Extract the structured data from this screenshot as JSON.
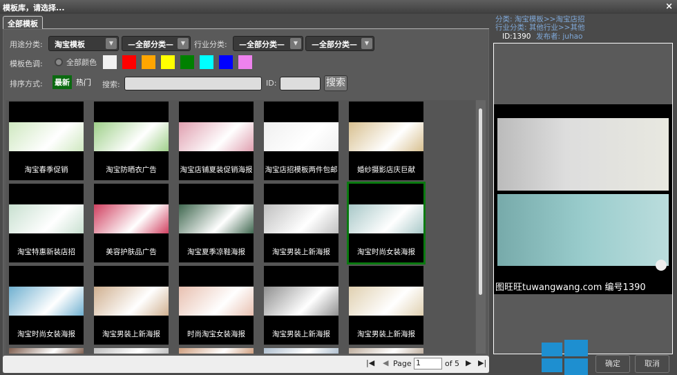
{
  "window": {
    "title": "模板库，请选择...",
    "close": "×"
  },
  "tab": "全部模板",
  "filters": {
    "usage_label": "用途分类:",
    "usage_value": "淘宝模板",
    "usage_sub": "—全部分类—",
    "industry_label": "行业分类:",
    "industry_value": "—全部分类—",
    "industry_sub": "—全部分类—",
    "color_label": "模板色调:",
    "all_colors": "全部颜色",
    "colors": [
      "#f2f2f2",
      "#ff0000",
      "#ffa500",
      "#ffff00",
      "#008000",
      "#00ffff",
      "#0000ff",
      "#ee82ee"
    ],
    "sort_label": "排序方式:",
    "sort_newest": "最新",
    "sort_hot": "热门",
    "search_label": "搜索:",
    "id_label": "ID:",
    "search_button": "搜索"
  },
  "templates": [
    {
      "name": "淘宝春季促销",
      "color": "#cfe8c0"
    },
    {
      "name": "淘宝防晒衣广告",
      "color": "#9fd08a"
    },
    {
      "name": "淘宝店铺夏装促销海报",
      "color": "#e0a0b0"
    },
    {
      "name": "淘宝店招模板两件包邮",
      "color": "#f0f0f0"
    },
    {
      "name": "婚纱摄影店庆巨献",
      "color": "#d8c090"
    },
    {
      "name": "淘宝特惠新装店招",
      "color": "#c8e0d0"
    },
    {
      "name": "美容护肤品广告",
      "color": "#d04060"
    },
    {
      "name": "淘宝夏季凉鞋海报",
      "color": "#406850"
    },
    {
      "name": "淘宝男装上新海报",
      "color": "#c0c0c0"
    },
    {
      "name": "淘宝时尚女装海报",
      "color": "#a8c8c8"
    },
    {
      "name": "淘宝时尚女装海报",
      "color": "#70b0d0"
    },
    {
      "name": "淘宝男装上新海报",
      "color": "#d0b090"
    },
    {
      "name": "时尚淘宝女装海报",
      "color": "#e8c0b0"
    },
    {
      "name": "淘宝男装上新海报",
      "color": "#909090"
    },
    {
      "name": "淘宝男装上新海报",
      "color": "#e0d0b0"
    },
    {
      "name": "",
      "color": "#806050"
    },
    {
      "name": "",
      "color": "#c0c0c0"
    },
    {
      "name": "",
      "color": "#d0a080"
    },
    {
      "name": "",
      "color": "#b0c0d0"
    },
    {
      "name": "",
      "color": "#c0b0a0"
    }
  ],
  "selected_index": 9,
  "pager": {
    "page_label": "Page",
    "page_value": "1",
    "of_label": "of",
    "total": "5"
  },
  "detail": {
    "category": "分类: 淘宝模板>>淘宝店招",
    "industry": "行业分类: 其他行业>>其他",
    "id": "ID:1390",
    "publisher": "发布者: juhao",
    "preview_caption": "图旺旺tuwangwang.com 编号1390"
  },
  "actions": {
    "ok": "确定",
    "cancel": "取消"
  }
}
